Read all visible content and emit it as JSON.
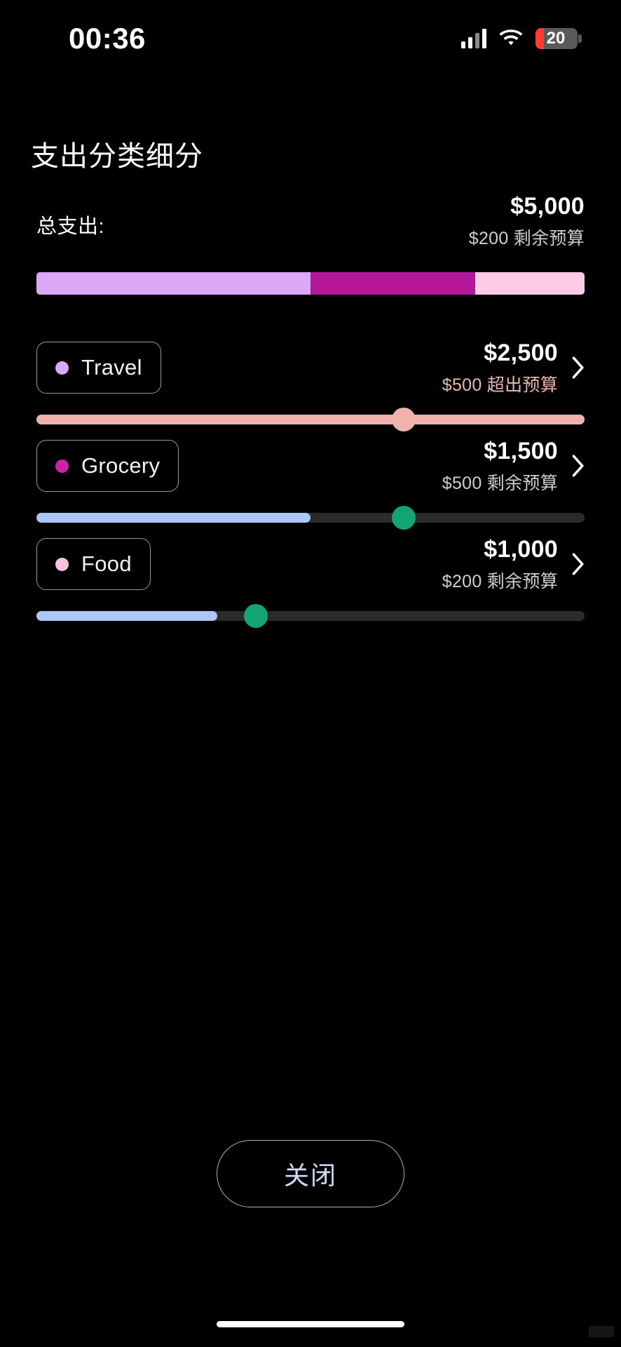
{
  "status_bar": {
    "time": "00:36",
    "signal_icon": "cellular-signal-icon",
    "wifi_icon": "wifi-icon",
    "battery_icon": "battery-icon",
    "battery_level": "20",
    "battery_percent": 20,
    "battery_color": "#ff3b30"
  },
  "header": {
    "title": "支出分类细分"
  },
  "total": {
    "label": "总支出:",
    "amount": "$5,000",
    "subtitle": "$200 剩余预算"
  },
  "segmented_bar": {
    "segments": [
      {
        "name": "Travel",
        "color": "#dfa7f7",
        "percent": 50
      },
      {
        "name": "Grocery",
        "color": "#b5179b",
        "percent": 30
      },
      {
        "name": "Food",
        "color": "#fbcbe8",
        "percent": 20
      }
    ],
    "track_color": "#1b1b1b"
  },
  "categories": [
    {
      "label": "Travel",
      "dot_color": "#dfa7f7",
      "amount": "$2,500",
      "subtitle": "$500 超出预算",
      "subtitle_color": "#e8b7b2",
      "chevron_icon": "chevron-right-icon",
      "slider": {
        "fill_color": "#f2b2ac",
        "fill_percent": 100,
        "thumb_color": "#f2b2ac",
        "thumb_percent": 67,
        "track_color": "#2b2b2b"
      }
    },
    {
      "label": "Grocery",
      "dot_color": "#cc21a8",
      "amount": "$1,500",
      "subtitle": "$500 剩余预算",
      "subtitle_color": "#cfcfcf",
      "chevron_icon": "chevron-right-icon",
      "slider": {
        "fill_color": "#aec6f5",
        "fill_percent": 50,
        "thumb_color": "#12a571",
        "thumb_percent": 67,
        "track_color": "#2b2b2b"
      }
    },
    {
      "label": "Food",
      "dot_color": "#fbbfe0",
      "amount": "$1,000",
      "subtitle": "$200 剩余预算",
      "subtitle_color": "#cfcfcf",
      "chevron_icon": "chevron-right-icon",
      "slider": {
        "fill_color": "#aec6f5",
        "fill_percent": 33,
        "thumb_color": "#12a571",
        "thumb_percent": 40,
        "track_color": "#2b2b2b"
      }
    }
  ],
  "footer": {
    "close_label": "关闭"
  }
}
